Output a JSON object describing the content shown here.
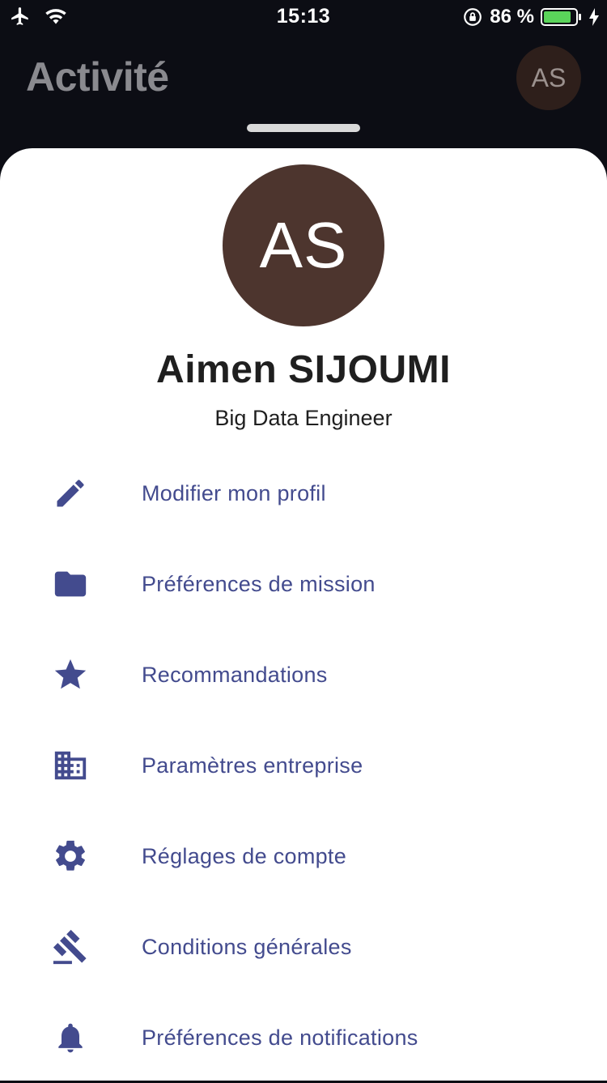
{
  "status_bar": {
    "time": "15:13",
    "battery_percent": "86 %"
  },
  "background": {
    "title": "Activité",
    "avatar_initials": "AS"
  },
  "profile": {
    "initials": "AS",
    "name": "Aimen SIJOUMI",
    "role": "Big Data Engineer"
  },
  "menu": {
    "items": [
      {
        "icon": "pencil-icon",
        "label": "Modifier mon profil"
      },
      {
        "icon": "folder-icon",
        "label": "Préférences de mission"
      },
      {
        "icon": "star-icon",
        "label": "Recommandations"
      },
      {
        "icon": "building-icon",
        "label": "Paramètres entreprise"
      },
      {
        "icon": "gear-icon",
        "label": "Réglages de compte"
      },
      {
        "icon": "gavel-icon",
        "label": "Conditions générales"
      },
      {
        "icon": "bell-icon",
        "label": "Préférences de notifications"
      }
    ]
  },
  "colors": {
    "accent": "#434b8e",
    "avatar_bg": "#4d352e",
    "header_bg": "#0c0d14"
  }
}
